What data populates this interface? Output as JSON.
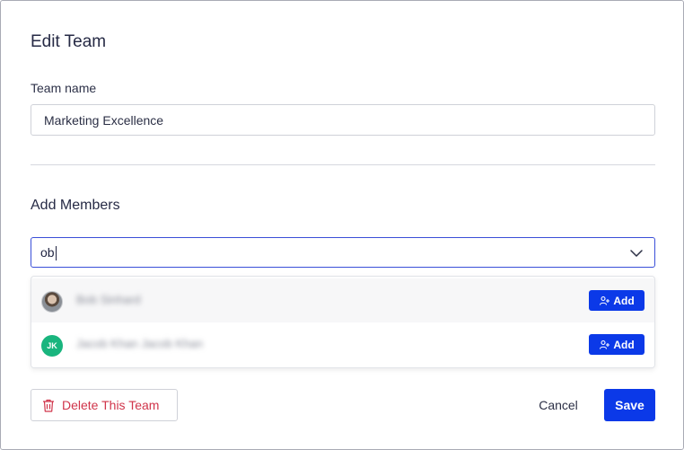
{
  "dialog": {
    "title": "Edit Team",
    "team_name_label": "Team name",
    "team_name_value": "Marketing Excellence",
    "add_members_label": "Add Members",
    "search_value": "ob"
  },
  "results": [
    {
      "name": "Bob Sinhard",
      "avatar": "photo",
      "initials": "",
      "add_label": "Add"
    },
    {
      "name": "Jacob Khan Jacob Khan",
      "avatar": "initials",
      "initials": "JK",
      "add_label": "Add"
    }
  ],
  "footer": {
    "delete_label": "Delete This Team",
    "cancel_label": "Cancel",
    "save_label": "Save"
  },
  "colors": {
    "primary": "#0b39e8",
    "danger": "#d0344a",
    "avatar_green": "#19b57e"
  },
  "icons": {
    "add_member": "user-plus-icon",
    "dropdown": "chevron-down-icon",
    "delete": "trash-icon"
  }
}
